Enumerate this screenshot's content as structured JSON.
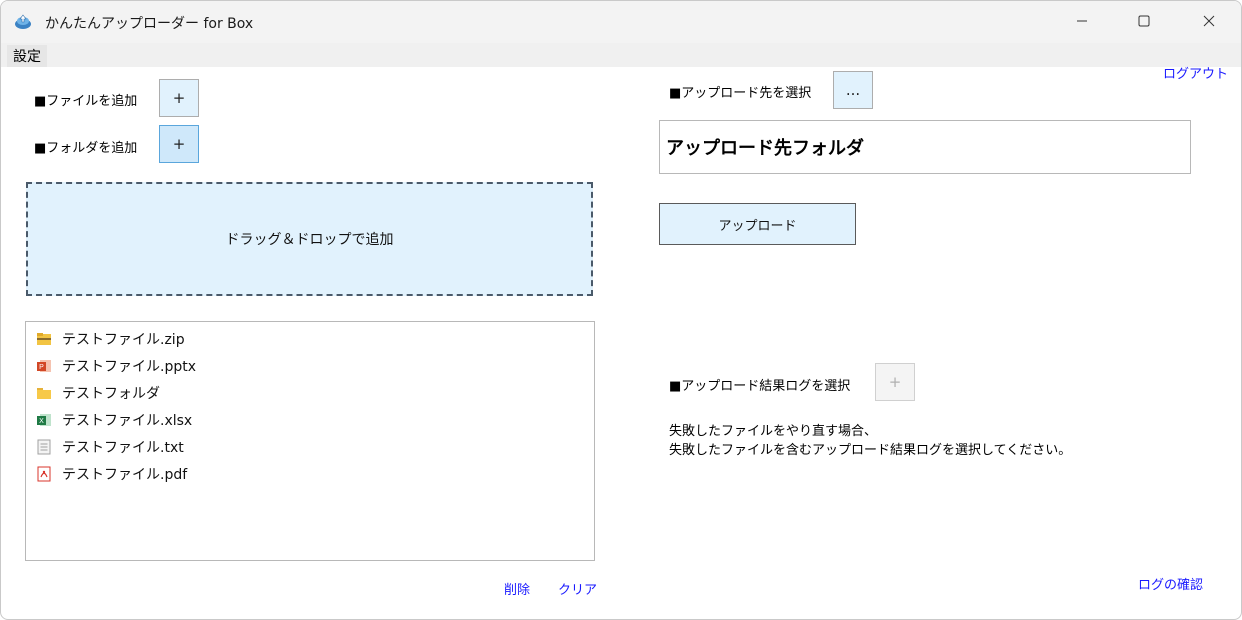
{
  "window": {
    "title": "かんたんアップローダー for Box",
    "minimize_icon": "minimize-icon",
    "maximize_icon": "maximize-icon",
    "close_icon": "close-icon"
  },
  "menu": {
    "settings": "設定"
  },
  "left": {
    "add_file_label": "■ファイルを追加",
    "add_file_button": "+",
    "add_folder_label": "■フォルダを追加",
    "add_folder_button": "+",
    "dropzone_text": "ドラッグ＆ドロップで追加",
    "files": [
      {
        "name": "テストファイル.zip",
        "icon": "zip-folder-icon"
      },
      {
        "name": "テストファイル.pptx",
        "icon": "powerpoint-icon"
      },
      {
        "name": "テストフォルダ",
        "icon": "folder-icon"
      },
      {
        "name": "テストファイル.xlsx",
        "icon": "excel-icon"
      },
      {
        "name": "テストファイル.txt",
        "icon": "text-file-icon"
      },
      {
        "name": "テストファイル.pdf",
        "icon": "pdf-icon"
      }
    ],
    "delete_link": "削除",
    "clear_link": "クリア"
  },
  "right": {
    "logout_link": "ログアウト",
    "select_dest_label": "■アップロード先を選択",
    "select_dest_button": "...",
    "dest_folder": "アップロード先フォルダ",
    "upload_button": "アップロード",
    "select_log_label": "■アップロード結果ログを選択",
    "select_log_button": "+",
    "note_line1": "失敗したファイルをやり直す場合、",
    "note_line2": "失敗したファイルを含むアップロード結果ログを選択してください。",
    "check_log_link": "ログの確認"
  },
  "colors": {
    "accent_link": "#1a1aff",
    "button_bg": "#e1f2fd"
  }
}
